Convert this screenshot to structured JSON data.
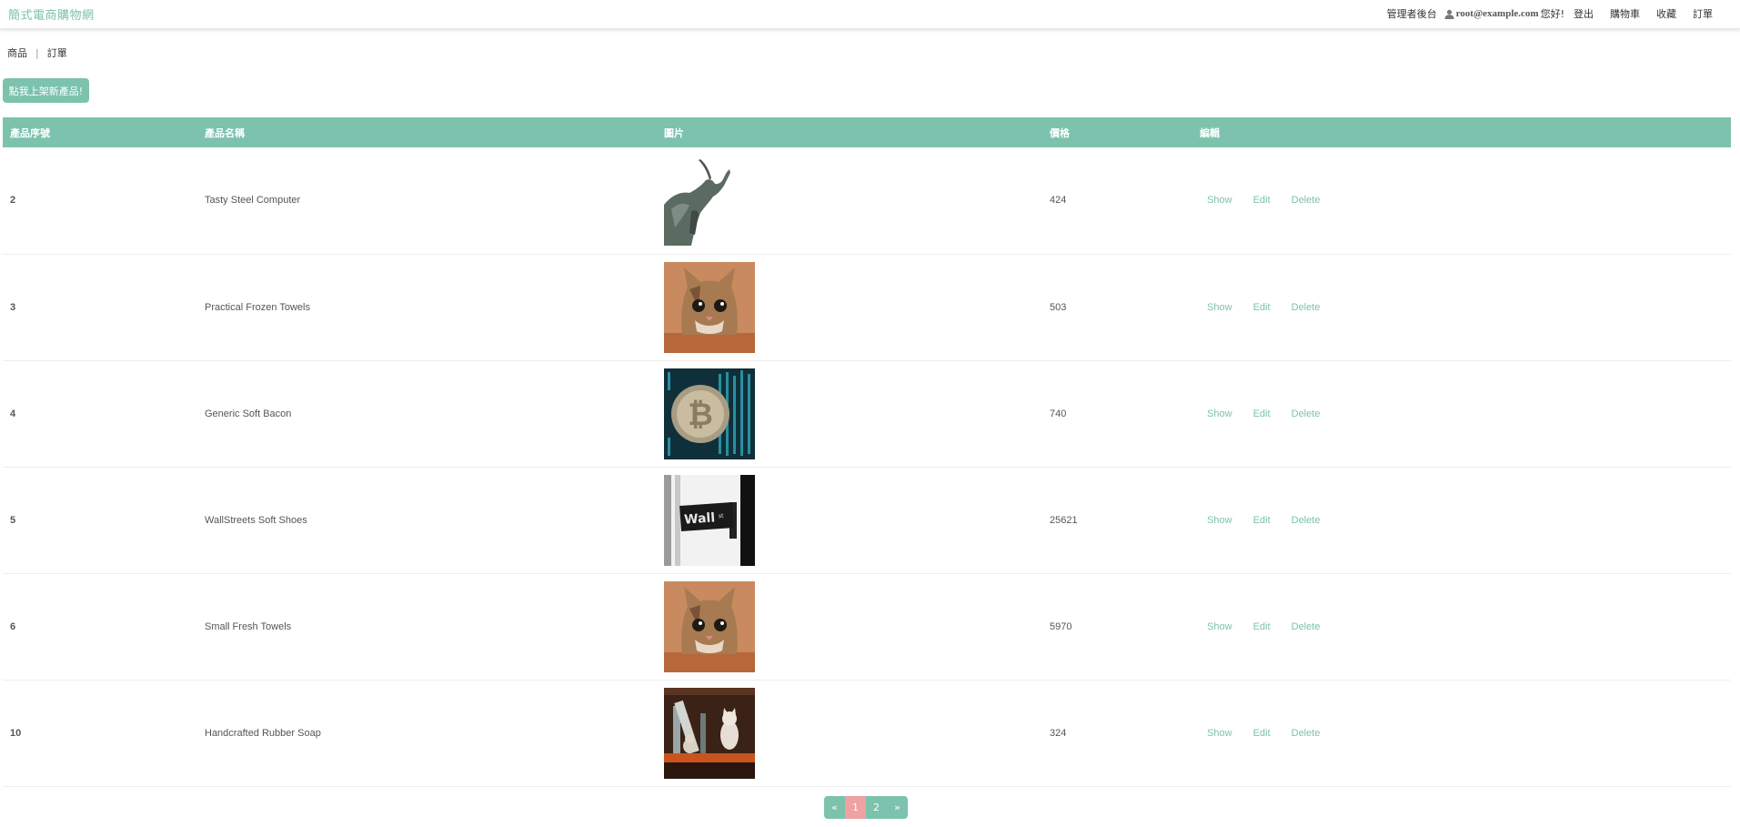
{
  "navbar": {
    "brand": "簡式電商購物網",
    "admin_link": "管理者後台",
    "user_email": "root@example.com",
    "greeting": "您好!",
    "logout": "登出",
    "cart": "購物車",
    "favorites": "收藏",
    "orders": "訂單",
    "user_icon": "user-icon"
  },
  "breadcrumb": {
    "products": "商品",
    "separator": "|",
    "orders": "訂單"
  },
  "add_button": "點我上架新產品!",
  "table": {
    "headers": [
      "產品序號",
      "產品名稱",
      "圖片",
      "價格",
      "編輯"
    ],
    "rows": [
      {
        "id": "2",
        "name": "Tasty Steel Computer",
        "image": "bull-statue-image",
        "price": "424"
      },
      {
        "id": "3",
        "name": "Practical Frozen Towels",
        "image": "cat-image",
        "price": "503"
      },
      {
        "id": "4",
        "name": "Generic Soft Bacon",
        "image": "bitcoin-image",
        "price": "740"
      },
      {
        "id": "5",
        "name": "WallStreets Soft Shoes",
        "image": "wall-street-sign-image",
        "price": "25621"
      },
      {
        "id": "6",
        "name": "Small Fresh Towels",
        "image": "cat-image",
        "price": "5970"
      },
      {
        "id": "10",
        "name": "Handcrafted Rubber Soap",
        "image": "kittens-bookshelf-image",
        "price": "324"
      }
    ],
    "actions": {
      "show": "Show",
      "edit": "Edit",
      "delete": "Delete"
    }
  },
  "pagination": {
    "prev": "«",
    "pages": [
      "1",
      "2"
    ],
    "active": "1",
    "next": "»"
  },
  "colors": {
    "accent": "#7cc2ad",
    "active_page": "#f0a1a1"
  }
}
